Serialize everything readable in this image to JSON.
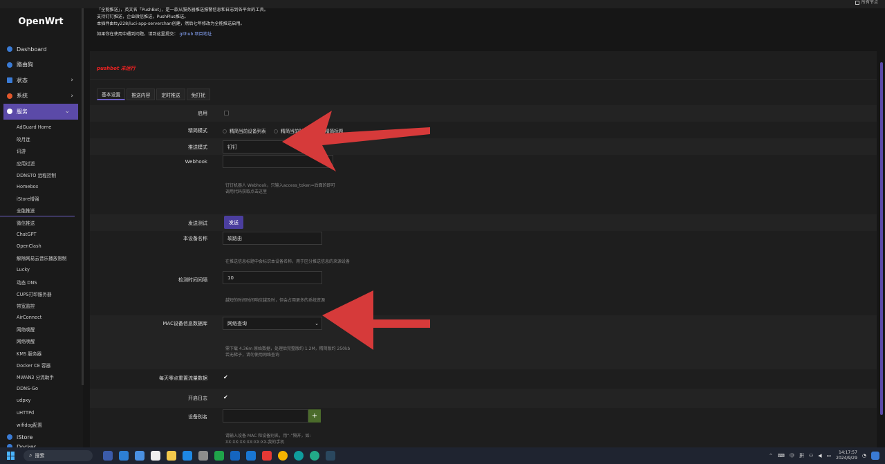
{
  "topbar": {
    "right_label": "所有节点"
  },
  "sidebar": {
    "logo": "OpenWrt",
    "items": [
      {
        "label": "Dashboard",
        "color": "#3a7bd5"
      },
      {
        "label": "路由狗",
        "color": "#3a7bd5"
      },
      {
        "label": "状态",
        "color": "#3a7bd5",
        "arrow": "›"
      },
      {
        "label": "系统",
        "color": "#e2572b",
        "arrow": "›"
      },
      {
        "label": "服务",
        "color": "#ffffff",
        "arrow": "⌄"
      }
    ],
    "subitems": [
      "AdGuard Home",
      "皎月连",
      "讯游",
      "应用过滤",
      "DDNSTO 远程控制",
      "Homebox",
      "iStore增强",
      "全能推送",
      "微信推送",
      "ChatGPT",
      "OpenClash",
      "解除网易云音乐播放限制",
      "Lucky",
      "动态 DNS",
      "CUPS打印服务器",
      "带宽监控",
      "AirConnect",
      "网络唤醒",
      "网络唤醒",
      "KMS 服务器",
      "Docker CE 容器",
      "MWAN3 分流助手",
      "DDNS-Go",
      "udpxy",
      "uHTTPd",
      "wifidog配置"
    ],
    "bottom_items": [
      "iStore",
      "Docker"
    ]
  },
  "intro": {
    "line1": "「全能推送」，英文名「PushBot」，是一款从服务器推送报警信息和日志到各平台的工具。",
    "line2": "支持钉钉推送，企业微信推送，PushPlus推送。",
    "line3": "本插件由tty228/luci-app-serverchan创建，然后七年修改为全能推送启用。",
    "line4": "如果你在使用中遇到问题，请到这里提交：",
    "link": "github 项目地址"
  },
  "status": "pushbot 未运行",
  "tabs": [
    "基本设置",
    "推送内容",
    "定时推送",
    "免打扰"
  ],
  "form": {
    "enable_label": "启用",
    "lite_label": "精简模式",
    "lite_options": [
      "精简当前设备列表",
      "精简当前时间",
      "精简标题"
    ],
    "push_mode_label": "推送模式",
    "push_mode_value": "钉钉",
    "webhook_label": "Webhook",
    "webhook_help1": "钉钉机器人 Webhook，只输入access_token=后面的即可",
    "webhook_help2": "调用代码获取点击这里",
    "send_test_label": "发送测试",
    "send_button": "发送",
    "device_name_label": "本设备名称",
    "device_name_value": "软路由",
    "device_name_help": "在推送信息标题中会标识本设备名称，用于区分推送信息的来源设备",
    "interval_label": "检测时间间隔",
    "interval_value": "10",
    "interval_help": "越短的时间时间响应越及时，但会占用更多的系统资源",
    "mac_label": "MAC设备信息数据库",
    "mac_value": "网络查询",
    "mac_help1": "需下载 4.36m 原始数据，处理后完整版约 1.2M，精简版约 250kb",
    "mac_help2": "若无梯子，请勿使用网络查询",
    "reset_label": "每天零点重置流量数据",
    "log_label": "开启日志",
    "alias_label": "设备别名",
    "alias_plus": "+",
    "alias_help1": "请输入设备 MAC 和设备别名，用“-”隔开，如:",
    "alias_help2": "XX:XX:XX:XX:XX:XX-我的手机"
  },
  "taskbar": {
    "search": "搜索",
    "tray_lang1": "中",
    "tray_lang2": "拼",
    "time": "14:17:57",
    "date": "2024/9/29"
  },
  "colors": {
    "accent": "#5b4aa8",
    "arrow": "#d63a3a",
    "status": "#e22222"
  }
}
